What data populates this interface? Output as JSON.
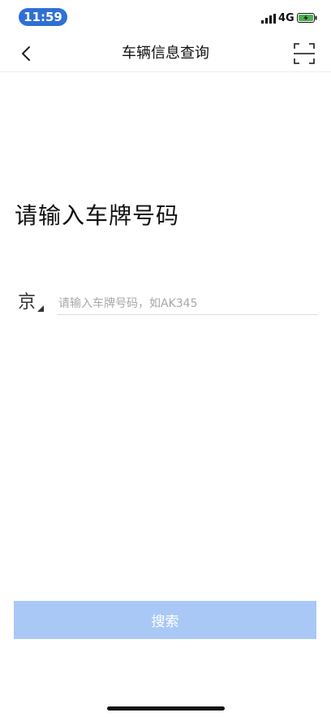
{
  "status_bar": {
    "time": "11:59",
    "network": "4G",
    "signal_icon": "signal-icon",
    "battery_icon": "battery-charging-icon",
    "time_pill_color": "#2f6fd6",
    "battery_color": "#4caf50"
  },
  "nav": {
    "title": "车辆信息查询",
    "back_icon": "chevron-left-icon",
    "scan_icon": "scan-icon"
  },
  "main": {
    "heading": "请输入车牌号码",
    "province": "京",
    "plate_placeholder": "请输入车牌号码，如AK345",
    "plate_value": ""
  },
  "actions": {
    "search_label": "搜索",
    "search_color": "#a9c8f6"
  }
}
